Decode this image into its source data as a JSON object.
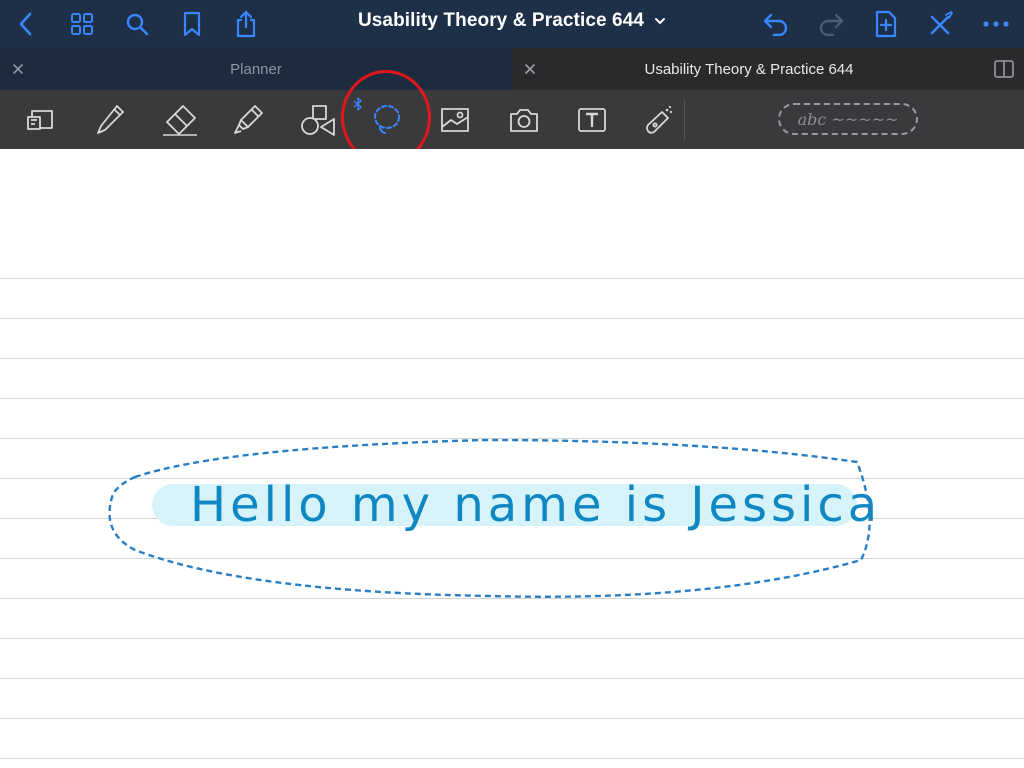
{
  "app": {
    "document_title": "Usability Theory & Practice 644"
  },
  "navbar": {
    "left_buttons": [
      "back-icon",
      "grid-icon",
      "search-icon",
      "bookmark-icon",
      "share-icon"
    ],
    "right_buttons": [
      "undo-icon",
      "redo-icon",
      "add-page-icon",
      "close-pen-icon",
      "more-icon"
    ]
  },
  "tabs": [
    {
      "label": "Planner",
      "active": false
    },
    {
      "label": "Usability Theory & Practice 644",
      "active": true
    }
  ],
  "toolbar": {
    "tools": [
      {
        "name": "zoom-box-tool",
        "icon": "zoom-box-icon"
      },
      {
        "name": "pen-tool",
        "icon": "pen-icon"
      },
      {
        "name": "eraser-tool",
        "icon": "eraser-icon"
      },
      {
        "name": "highlighter-tool",
        "icon": "highlighter-icon"
      },
      {
        "name": "shapes-tool",
        "icon": "shapes-icon"
      },
      {
        "name": "lasso-tool",
        "icon": "lasso-icon",
        "selected": true
      },
      {
        "name": "image-tool",
        "icon": "image-icon"
      },
      {
        "name": "camera-tool",
        "icon": "camera-icon"
      },
      {
        "name": "text-tool",
        "icon": "text-box-icon"
      },
      {
        "name": "laser-pointer-tool",
        "icon": "laser-pointer-icon"
      }
    ],
    "handwriting_preview": "abc ~~~~~"
  },
  "canvas": {
    "handwriting": "Hello my name is Jessica"
  },
  "colors": {
    "nav_bg": "#1e3047",
    "accent_blue": "#3a86ff",
    "toolbar_bg": "#3a3a3d",
    "ink": "#0f87c2",
    "ink_highlight": "#d7f3fa",
    "lasso": "#2a7fc4",
    "callout_ring": "#e0161d"
  }
}
